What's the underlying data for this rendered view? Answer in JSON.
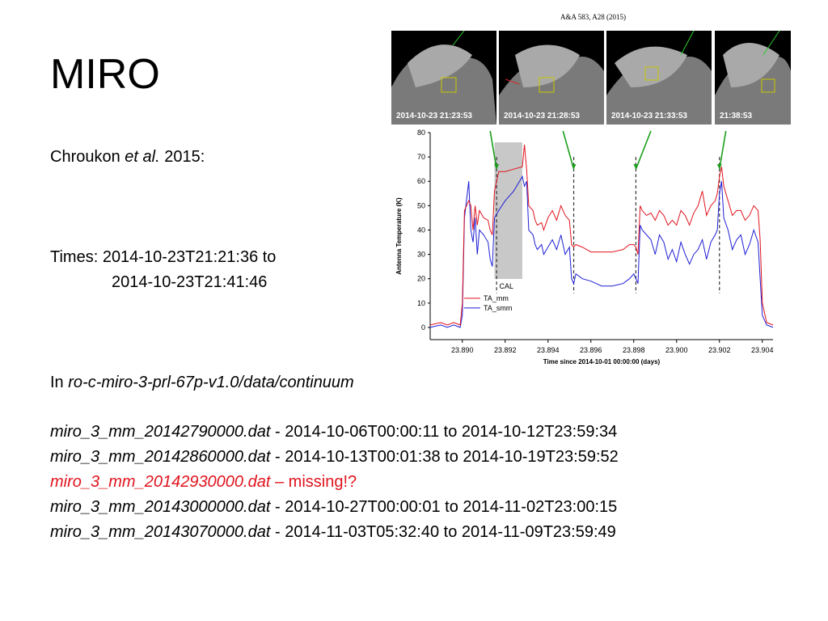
{
  "slide": {
    "title": "MIRO",
    "citation": "A&A 583, A28 (2015)",
    "source_author": "Chroukon",
    "source_etal": "et al.",
    "source_year": "2015:",
    "times_label": "Times: 2014-10-23T21:21:36 to",
    "times_end": "2014-10-23T21:41:46",
    "dir_prefix": "In ",
    "dir_path": "ro-c-miro-3-prl-67p-v1.0/data/continuum",
    "files": [
      {
        "name": "miro_3_mm_20142790000.dat",
        "sep": " - ",
        "range": "2014-10-06T00:00:11 to 2014-10-12T23:59:34",
        "missing": false
      },
      {
        "name": "miro_3_mm_20142860000.dat",
        "sep": " - ",
        "range": "2014-10-13T00:01:38 to 2014-10-19T23:59:52",
        "missing": false
      },
      {
        "name": "miro_3_mm_20142930000.dat",
        "sep": " – ",
        "range": "missing!?",
        "missing": true
      },
      {
        "name": "miro_3_mm_20143000000.dat",
        "sep": " - ",
        "range": "2014-10-27T00:00:01 to 2014-11-02T23:00:15",
        "missing": false
      },
      {
        "name": "miro_3_mm_20143070000.dat",
        "sep": " - ",
        "range": "2014-11-03T05:32:40 to 2014-11-09T23:59:49",
        "missing": false
      }
    ],
    "missing_color": "#e0141e"
  },
  "photos": [
    {
      "timestamp": "2014-10-23  21:23:53"
    },
    {
      "timestamp": "2014-10-23  21:28:53"
    },
    {
      "timestamp": "2014-10-23  21:33:53"
    },
    {
      "timestamp": "21:38:53"
    }
  ],
  "chart_data": {
    "type": "line",
    "xlabel": "Time since 2014-10-01 00:00:00 (days)",
    "ylabel": "Antenna Temperature (K)",
    "xlim": [
      23.8885,
      23.9045
    ],
    "ylim": [
      -5,
      80
    ],
    "xticks": [
      "23.890",
      "23.892",
      "23.894",
      "23.896",
      "23.898",
      "23.900",
      "23.902",
      "23.904"
    ],
    "xtick_values": [
      23.89,
      23.892,
      23.894,
      23.896,
      23.898,
      23.9,
      23.902,
      23.904
    ],
    "yticks": [
      0,
      10,
      20,
      30,
      40,
      50,
      60,
      70,
      80
    ],
    "cal_band": [
      23.8915,
      23.8928
    ],
    "cal_label": "CAL",
    "dashed_markers": [
      23.8916,
      23.8952,
      23.8981,
      23.902
    ],
    "arrows": [
      [
        23.8916,
        23.8913
      ],
      [
        23.8952,
        23.8947
      ],
      [
        23.8981,
        23.8988
      ],
      [
        23.902,
        23.9023
      ]
    ],
    "series": [
      {
        "name": "TA_smm",
        "color": "#1f1fd6",
        "x": [
          23.8885,
          23.889,
          23.8893,
          23.8896,
          23.8899,
          23.89,
          23.8901,
          23.8903,
          23.8904,
          23.8905,
          23.8906,
          23.8907,
          23.8908,
          23.891,
          23.8912,
          23.8913,
          23.8914,
          23.8915,
          23.8917,
          23.892,
          23.8924,
          23.8928,
          23.8929,
          23.893,
          23.8931,
          23.8933,
          23.8934,
          23.8935,
          23.8937,
          23.8938,
          23.894,
          23.8942,
          23.8944,
          23.8946,
          23.8948,
          23.895,
          23.8951,
          23.8952,
          23.8953,
          23.8956,
          23.896,
          23.8965,
          23.897,
          23.8975,
          23.8978,
          23.898,
          23.8981,
          23.8982,
          23.8983,
          23.8984,
          23.8986,
          23.8988,
          23.899,
          23.8992,
          23.8994,
          23.8996,
          23.8998,
          23.9,
          23.9002,
          23.9004,
          23.9006,
          23.9008,
          23.901,
          23.9012,
          23.9014,
          23.9016,
          23.9018,
          23.9019,
          23.902,
          23.9021,
          23.9022,
          23.9024,
          23.9026,
          23.9028,
          23.903,
          23.9032,
          23.9034,
          23.9036,
          23.9038,
          23.9039,
          23.904,
          23.9042,
          23.9045
        ],
        "y": [
          0,
          1,
          0,
          1,
          0,
          5,
          45,
          60,
          40,
          35,
          45,
          30,
          40,
          38,
          35,
          28,
          25,
          45,
          48,
          52,
          56,
          62,
          58,
          60,
          40,
          38,
          34,
          32,
          34,
          30,
          33,
          36,
          32,
          38,
          30,
          33,
          20,
          18,
          22,
          20,
          19,
          17,
          17,
          18,
          20,
          22,
          20,
          18,
          42,
          40,
          38,
          36,
          30,
          38,
          35,
          28,
          32,
          27,
          35,
          30,
          26,
          30,
          32,
          36,
          28,
          35,
          38,
          40,
          55,
          60,
          45,
          40,
          32,
          36,
          38,
          30,
          34,
          40,
          35,
          20,
          5,
          1,
          0
        ]
      },
      {
        "name": "TA_mm",
        "color": "#e0141e",
        "x": [
          23.8885,
          23.889,
          23.8893,
          23.8896,
          23.8899,
          23.89,
          23.8901,
          23.8903,
          23.8904,
          23.8905,
          23.8906,
          23.8907,
          23.8908,
          23.891,
          23.8912,
          23.8913,
          23.8914,
          23.8915,
          23.8917,
          23.892,
          23.8924,
          23.8928,
          23.8929,
          23.893,
          23.8931,
          23.8933,
          23.8934,
          23.8935,
          23.8937,
          23.8938,
          23.894,
          23.8942,
          23.8944,
          23.8946,
          23.8948,
          23.895,
          23.8951,
          23.8952,
          23.8953,
          23.8956,
          23.896,
          23.8965,
          23.897,
          23.8975,
          23.8978,
          23.898,
          23.8981,
          23.8982,
          23.8983,
          23.8984,
          23.8986,
          23.8988,
          23.899,
          23.8992,
          23.8994,
          23.8996,
          23.8998,
          23.9,
          23.9002,
          23.9004,
          23.9006,
          23.9008,
          23.901,
          23.9012,
          23.9014,
          23.9016,
          23.9018,
          23.9019,
          23.902,
          23.9021,
          23.9022,
          23.9024,
          23.9026,
          23.9028,
          23.903,
          23.9032,
          23.9034,
          23.9036,
          23.9038,
          23.9039,
          23.904,
          23.9042,
          23.9045
        ],
        "y": [
          1,
          2,
          1,
          2,
          1,
          10,
          48,
          52,
          50,
          40,
          50,
          42,
          48,
          45,
          44,
          40,
          38,
          56,
          64,
          64,
          65,
          66,
          75,
          65,
          50,
          48,
          44,
          42,
          43,
          40,
          45,
          48,
          44,
          50,
          46,
          44,
          34,
          33,
          34,
          33,
          31,
          31,
          31,
          32,
          34,
          34,
          33,
          30,
          50,
          48,
          46,
          47,
          44,
          48,
          46,
          42,
          44,
          42,
          48,
          46,
          42,
          47,
          50,
          56,
          46,
          50,
          52,
          55,
          62,
          66,
          58,
          52,
          46,
          48,
          48,
          44,
          46,
          50,
          48,
          36,
          10,
          2,
          1
        ]
      }
    ]
  }
}
